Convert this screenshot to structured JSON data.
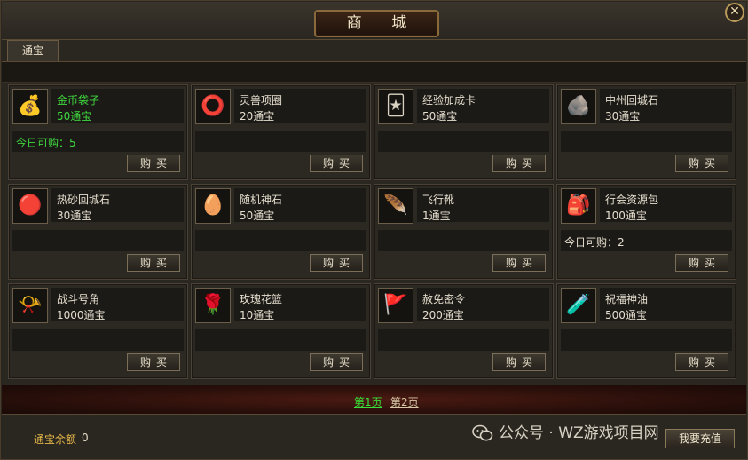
{
  "window": {
    "title": "商 城",
    "close_label": "✕"
  },
  "tabs": [
    {
      "label": "通宝"
    }
  ],
  "items": [
    {
      "name": "金币袋子",
      "price": "50通宝",
      "limit": "今日可购：5",
      "highlight": true,
      "icon": "gold-coin-bag",
      "buy_label": "购买"
    },
    {
      "name": "灵兽项圈",
      "price": "20通宝",
      "limit": "",
      "highlight": false,
      "icon": "pet-collar",
      "buy_label": "购买"
    },
    {
      "name": "经验加成卡",
      "price": "50通宝",
      "limit": "",
      "highlight": false,
      "icon": "exp-bonus-card",
      "buy_label": "购买"
    },
    {
      "name": "中州回城石",
      "price": "30通宝",
      "limit": "",
      "highlight": false,
      "icon": "return-stone",
      "buy_label": "购买"
    },
    {
      "name": "热砂回城石",
      "price": "30通宝",
      "limit": "",
      "highlight": false,
      "icon": "red-return-stone",
      "buy_label": "购买"
    },
    {
      "name": "随机神石",
      "price": "50通宝",
      "limit": "",
      "highlight": false,
      "icon": "random-stone",
      "buy_label": "购买"
    },
    {
      "name": "飞行靴",
      "price": "1通宝",
      "limit": "",
      "highlight": false,
      "icon": "flying-boots",
      "buy_label": "购买"
    },
    {
      "name": "行会资源包",
      "price": "100通宝",
      "limit": "今日可购：2",
      "highlight": false,
      "icon": "guild-resource-pack",
      "buy_label": "购买"
    },
    {
      "name": "战斗号角",
      "price": "1000通宝",
      "limit": "",
      "highlight": false,
      "icon": "battle-horn",
      "buy_label": "购买"
    },
    {
      "name": "玫瑰花篮",
      "price": "10通宝",
      "limit": "",
      "highlight": false,
      "icon": "rose-basket",
      "buy_label": "购买"
    },
    {
      "name": "赦免密令",
      "price": "200通宝",
      "limit": "",
      "highlight": false,
      "icon": "pardon-order",
      "buy_label": "购买"
    },
    {
      "name": "祝福神油",
      "price": "500通宝",
      "limit": "",
      "highlight": false,
      "icon": "blessing-oil",
      "buy_label": "购买"
    }
  ],
  "pager": {
    "page1": "第1页",
    "page2": "第2页",
    "current": 1
  },
  "footer": {
    "balance_label": "通宝余额",
    "balance_value": "0",
    "recharge_label": "我要充值",
    "watermark": "公众号 · WZ游戏项目网"
  },
  "colors": {
    "highlight_green": "#3fd83f",
    "gold_label": "#e6b94a"
  }
}
